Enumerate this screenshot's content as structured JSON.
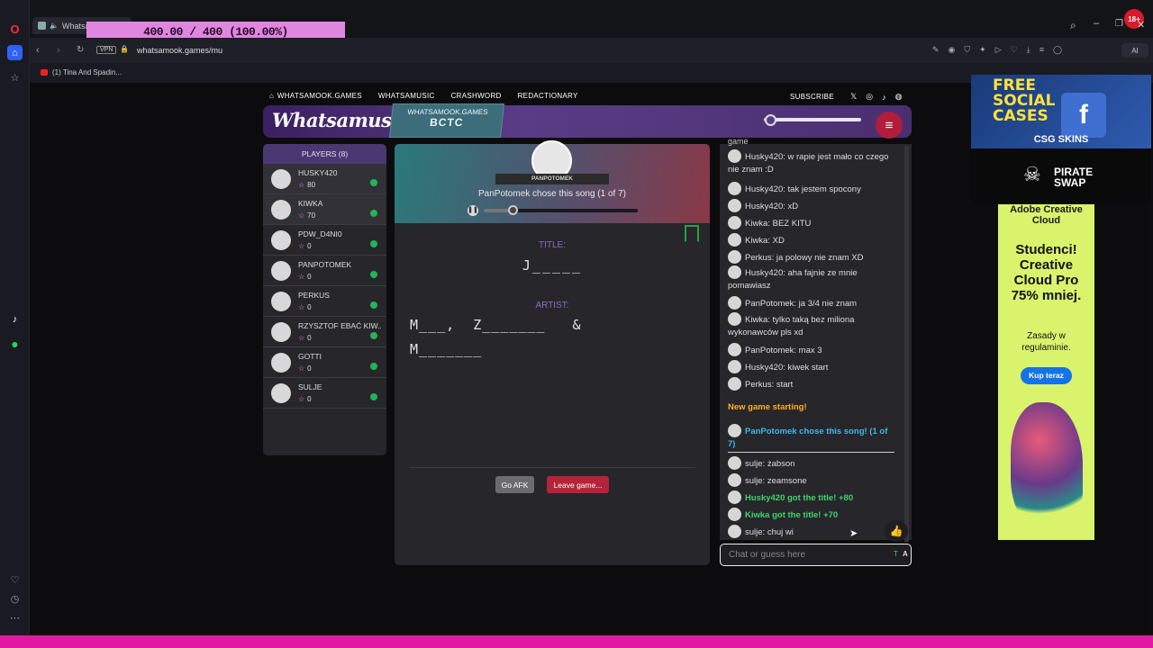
{
  "browser": {
    "tab_title": "Whatsam",
    "overlay_text": "400.00 / 400 (100.00%)",
    "url": "whatsamook.games/mu",
    "vpn": "VPN",
    "bookmark": "(1) Tina And Spadin...",
    "ai": "AI",
    "badge_18": "18+"
  },
  "nav": {
    "items": [
      "WHATSAMOOK.GAMES",
      "WHATSAMUSIC",
      "CRASHWORD",
      "REDACTIONARY"
    ],
    "subscribe": "SUBSCRIBE"
  },
  "header": {
    "logo": "Whatsamusic",
    "badge_top": "WHATSAMOOK.GAMES",
    "badge_bottom": "BCTC"
  },
  "players": {
    "title": "PLAYERS (8)",
    "list": [
      {
        "name": "HUSKY420",
        "score": "80"
      },
      {
        "name": "KIWKA",
        "score": "70"
      },
      {
        "name": "PDW_D4NI0",
        "score": "0"
      },
      {
        "name": "PANPOTOMEK",
        "score": "0"
      },
      {
        "name": "PERKUS",
        "score": "0"
      },
      {
        "name": "RZYSZTOF EBAĆ KIW...",
        "score": "0"
      },
      {
        "name": "GOTTI",
        "score": "0"
      },
      {
        "name": "SULJE",
        "score": "0"
      }
    ]
  },
  "game": {
    "chooser_ribbon": "PANPOTOMEK",
    "status": "PanPotomek chose this song (1 of 7)",
    "title_label": "TITLE:",
    "title_hint": "J_____",
    "artist_label": "ARTIST:",
    "artist_line1": "M___,  Z_______   &",
    "artist_line2": "M_______",
    "afk_button": "Go AFK",
    "leave_button": "Leave game...",
    "playback_progress": 0.19
  },
  "chat": {
    "cut_text": "game",
    "messages": [
      {
        "t": "Husky420: w rapie jest mało co czego nie znam :D"
      },
      {
        "t": "Husky420: tak jestem spocony"
      },
      {
        "t": "Husky420: xD"
      },
      {
        "t": "Kiwka: BEZ KITU"
      },
      {
        "t": "Kiwka: XD"
      },
      {
        "t": "Perkus: ja polowy nie znam XD"
      },
      {
        "t": "Husky420: aha fajnie ze mnie pomawiasz"
      },
      {
        "t": "PanPotomek: ja 3/4 nie znam"
      },
      {
        "t": "Kiwka: tylko taką bez miliona wykonawców pls xd"
      },
      {
        "t": "PanPotomek: max 3"
      },
      {
        "t": "Husky420: kiwek start"
      },
      {
        "t": "Perkus: start"
      }
    ],
    "new_game": "New game starting!",
    "chose": "PanPotomek chose this song! (1 of 7)",
    "messages2": [
      {
        "t": "sulje: żabson",
        "c": "#dedede"
      },
      {
        "t": "sulje: zeamsone",
        "c": "#dedede"
      },
      {
        "t": "Husky420 got the title! +80",
        "c": "#3fd46a"
      },
      {
        "t": "Kiwka got the title! +70",
        "c": "#3fd46a"
      },
      {
        "t": "sulje: chuj wi",
        "c": "#dedede"
      }
    ],
    "placeholder": "Chat or guess here",
    "input_tag": "A"
  },
  "ads": {
    "csg_title": "FREE SOCIAL CASES",
    "csg_brand": "CSG SKINS",
    "pirate": "PIRATE SWAP",
    "adobe_brand": "Adobe Creative Cloud",
    "adobe_text": "Studenci! Creative Cloud Pro 75% mniej.",
    "adobe_small": "Zasady w regulaminie.",
    "adobe_btn": "Kup teraz"
  },
  "colors": {
    "accent_purple": "#5a3c86",
    "success": "#22b455",
    "leave": "#b5243a",
    "pink_bar": "#e01aa0",
    "overlay": "#df86df"
  }
}
